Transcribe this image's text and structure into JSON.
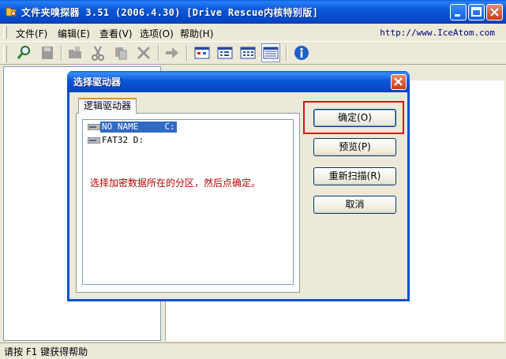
{
  "window": {
    "title": "文件夹嗅探器 3.51 (2006.4.30) [Drive Rescue内核特别版]",
    "url_text": "http://www.IceAtom.com"
  },
  "menu": {
    "items": [
      {
        "label": "文件(F)"
      },
      {
        "label": "编辑(E)"
      },
      {
        "label": "查看(V)"
      },
      {
        "label": "选项(O)"
      },
      {
        "label": "帮助(H)"
      }
    ]
  },
  "toolbar": {
    "buttons": [
      "find-icon",
      "save-icon",
      "paste-folder-icon",
      "cut-icon",
      "copy-icon",
      "delete-icon",
      "move-icon",
      "large-icons-view-icon",
      "small-icons-view-icon",
      "list-view-icon",
      "details-view-icon",
      "info-icon"
    ],
    "active": "details-view-icon"
  },
  "dialog": {
    "title": "选择驱动器",
    "tab_label": "逻辑驱动器",
    "drives": [
      {
        "label": "NO NAME     C:",
        "selected": true
      },
      {
        "label": "FAT32 D:",
        "selected": false
      }
    ],
    "hint": "选择加密数据所在的分区，然后点确定。",
    "buttons": {
      "ok": "确定(O)",
      "preview": "预览(P)",
      "rescan": "重新扫描(R)",
      "cancel": "取消"
    }
  },
  "status": {
    "text": "请按 F1 键获得帮助"
  },
  "colors": {
    "title_blue": "#0a58d8",
    "face": "#ece9d8",
    "hint_red": "#c00000",
    "highlight_red": "#e01010",
    "selection": "#316ac5"
  }
}
